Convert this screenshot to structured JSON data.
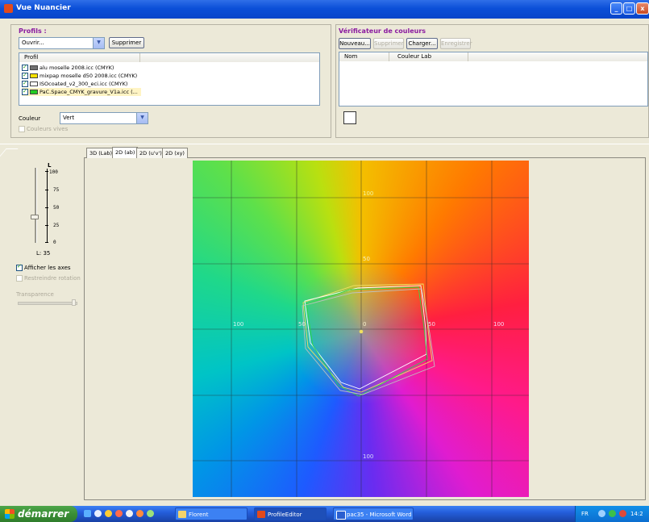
{
  "window": {
    "title": "Vue Nuancier"
  },
  "profiles": {
    "title": "Profils :",
    "open_combo_value": "Ouvrir...",
    "delete_label": "Supprimer",
    "column_header": "Profil",
    "items": [
      {
        "label": "alu moselle 2008.icc (CMYK)",
        "checked": true,
        "color": "#707070"
      },
      {
        "label": "mixpap moselle d50 2008.icc (CMYK)",
        "checked": true,
        "color": "#f5e100"
      },
      {
        "label": "ISOcoated_v2_300_eci.icc (CMYK)",
        "checked": true,
        "color": "#ffffff"
      },
      {
        "label": "PaC.Space_CMYK_gravure_V1a.icc (...",
        "checked": true,
        "color": "#22cc22"
      }
    ],
    "color_label": "Couleur",
    "color_value": "Vert",
    "vivid_colors_label": "Couleurs vives"
  },
  "checker": {
    "title": "Vérificateur de couleurs",
    "new_label": "Nouveau...",
    "delete_label": "Supprimer",
    "load_label": "Charger...",
    "save_label": "Enregistrer",
    "col_name": "Nom",
    "col_lab": "Couleur Lab"
  },
  "controls": {
    "l_axis_label": "L",
    "l_ticks": [
      "100",
      "75",
      "50",
      "25",
      "0"
    ],
    "l_value": "L: 35",
    "l_fraction": 0.35,
    "show_axes_label": "Afficher les axes",
    "restrict_rotation_label": "Restreindre rotation",
    "transparency_label": "Transparence"
  },
  "tabs": [
    {
      "label": "3D (Lab)",
      "active": false
    },
    {
      "label": "2D (ab)",
      "active": true
    },
    {
      "label": "2D (u'v')",
      "active": false
    },
    {
      "label": "2D (xy)",
      "active": false
    }
  ],
  "plot": {
    "axis_labels": {
      "top": "100",
      "upper": "50",
      "left": "100",
      "inner_left": "50",
      "center": "0",
      "inner_right": "50",
      "right": "100",
      "bottom": "100"
    },
    "gamut_colors": [
      "#f0e060",
      "#ffffff",
      "#2fd84a",
      "#c0c0c0"
    ]
  },
  "taskbar": {
    "start_label": "démarrer",
    "tasks": [
      {
        "label": "Florent",
        "active": false
      },
      {
        "label": "ProfileEditor",
        "active": true
      },
      {
        "label": "pac35 - Microsoft Word",
        "active": false
      }
    ],
    "lang": "FR",
    "clock": "14:2"
  }
}
